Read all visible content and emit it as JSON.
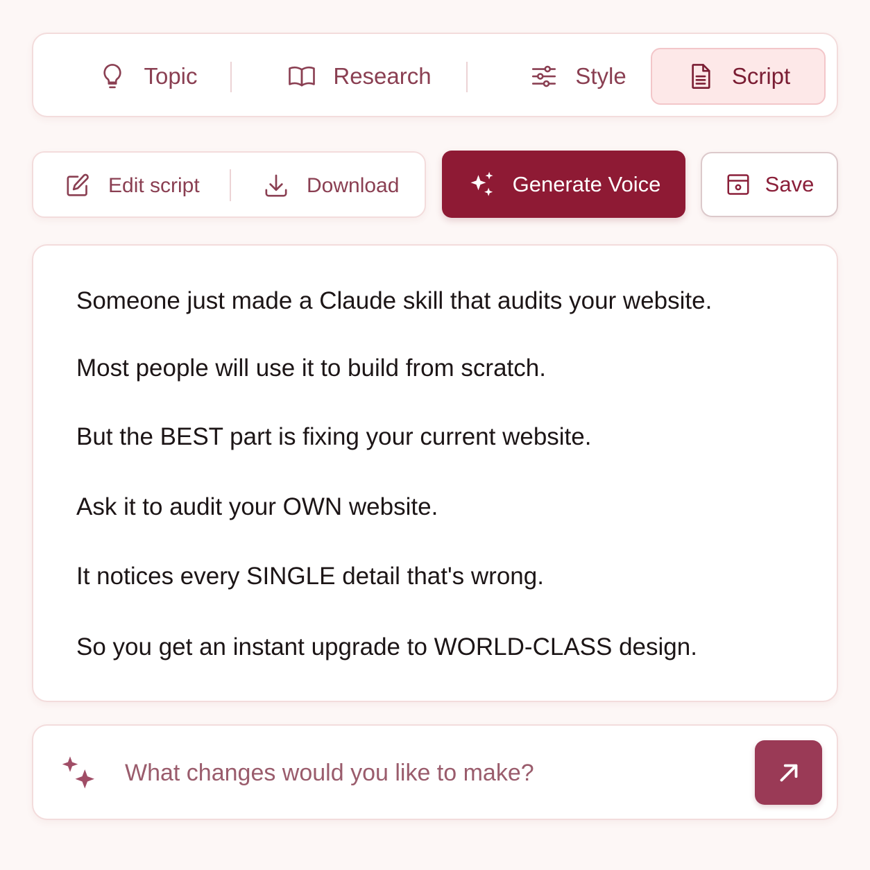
{
  "steps": {
    "items": [
      {
        "label": "Topic",
        "icon": "lightbulb-icon"
      },
      {
        "label": "Research",
        "icon": "book-icon"
      },
      {
        "label": "Style",
        "icon": "sliders-icon"
      },
      {
        "label": "Script",
        "icon": "document-icon",
        "active": true
      }
    ]
  },
  "toolbar": {
    "edit_label": "Edit script",
    "download_label": "Download",
    "generate_label": "Generate Voice",
    "save_label": "Save"
  },
  "script": {
    "lines": [
      "Someone just made a Claude skill that audits your website.",
      "Most people will use it to build from scratch.",
      "But the BEST part is fixing your current website.",
      "Ask it to audit your OWN website.",
      "It notices every SINGLE detail that's wrong.",
      "So you get an instant upgrade to WORLD-CLASS design."
    ]
  },
  "prompt": {
    "placeholder": "What changes would you like to make?",
    "value": ""
  },
  "colors": {
    "accent": "#8e1a34",
    "send_button": "#9a3a56",
    "active_tab_bg": "#fde8e8",
    "muted_text": "#8a3f52",
    "background": "#fdf7f6"
  }
}
